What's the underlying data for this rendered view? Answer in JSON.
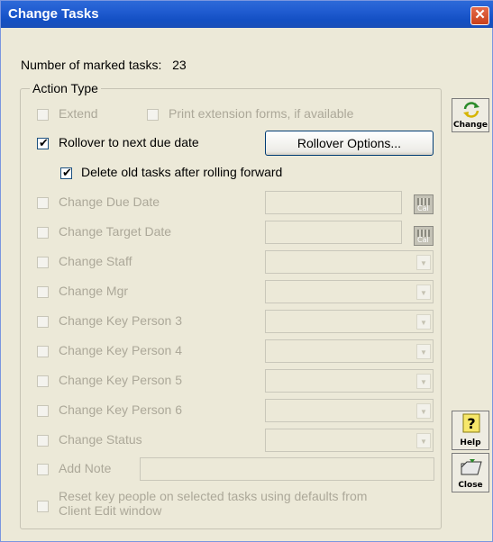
{
  "window": {
    "title": "Change Tasks",
    "close_glyph": "✕"
  },
  "marked": {
    "label": "Number of marked tasks:",
    "count": "23"
  },
  "group": {
    "caption": "Action Type",
    "extend": "Extend",
    "print_ext": "Print extension forms, if available",
    "rollover": "Rollover to next due date",
    "rollover_btn": "Rollover Options...",
    "delete_old": "Delete old tasks after rolling forward",
    "due_date": "Change Due Date",
    "target_date": "Change Target Date",
    "staff": "Change Staff",
    "mgr": "Change Mgr",
    "kp3": "Change Key Person 3",
    "kp4": "Change Key Person 4",
    "kp5": "Change Key Person 5",
    "kp6": "Change Key Person 6",
    "status": "Change Status",
    "add_note": "Add Note",
    "reset_line1": "Reset key people on selected tasks using defaults from",
    "reset_line2": "Client Edit window",
    "cal_label": "Cal",
    "check_glyph": "✔",
    "arrow_glyph": "▼"
  },
  "states": {
    "rollover_checked": true,
    "delete_old_checked": true
  },
  "side": {
    "change": "Change",
    "help": "Help",
    "close": "Close"
  },
  "colors": {
    "title_bar": "#1f5bd0",
    "close_button": "#d5512b",
    "disabled_text": "#aca899",
    "face": "#ece9d8"
  }
}
